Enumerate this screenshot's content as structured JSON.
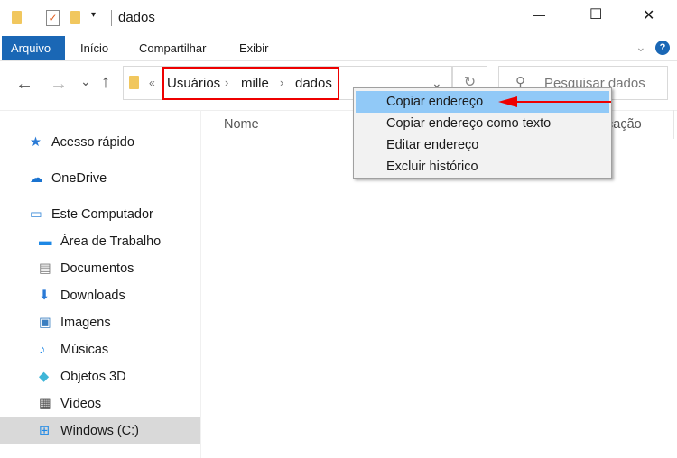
{
  "window": {
    "title": "dados",
    "minimize": "—",
    "maximize": "☐",
    "close": "✕"
  },
  "ribbon": {
    "tabs": [
      "Arquivo",
      "Início",
      "Compartilhar",
      "Exibir"
    ],
    "active_color": "#1a67b5"
  },
  "nav": {
    "back": "←",
    "forward": "→",
    "recent": "⌄",
    "up": "↑",
    "refresh": "↻",
    "overflow": "«"
  },
  "breadcrumb": [
    "Usuários",
    "mille",
    "dados"
  ],
  "search": {
    "placeholder": "Pesquisar dados"
  },
  "columns": {
    "name": "Nome",
    "partial": "cação"
  },
  "sidebar": [
    {
      "label": "Acesso rápido",
      "icon": "star-icon"
    },
    {
      "label": "OneDrive",
      "icon": "cloud-icon"
    },
    {
      "label": "Este Computador",
      "icon": "computer-icon"
    },
    {
      "label": "Área de Trabalho",
      "icon": "desktop-icon"
    },
    {
      "label": "Documentos",
      "icon": "document-icon"
    },
    {
      "label": "Downloads",
      "icon": "download-icon"
    },
    {
      "label": "Imagens",
      "icon": "image-icon"
    },
    {
      "label": "Músicas",
      "icon": "music-icon"
    },
    {
      "label": "Objetos 3D",
      "icon": "cube-icon"
    },
    {
      "label": "Vídeos",
      "icon": "video-icon"
    },
    {
      "label": "Windows (C:)",
      "icon": "drive-icon",
      "selected": true
    }
  ],
  "context_menu": [
    "Copiar endereço",
    "Copiar endereço como texto",
    "Editar endereço",
    "Excluir histórico"
  ],
  "colors": {
    "highlight": "#e00000",
    "menu_hover": "#91c9f7"
  }
}
